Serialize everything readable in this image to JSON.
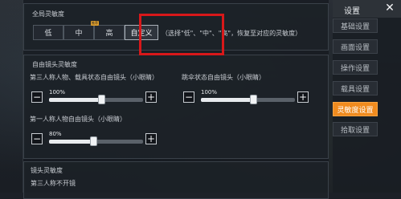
{
  "global": {
    "title": "全局灵敏度",
    "buttons": [
      "低",
      "中",
      "高",
      "自定义"
    ],
    "badge": "推荐",
    "hint": "（选择\"低\"、\"中\"、\"高\"，恢复至对应的灵敏度）"
  },
  "free_cam": {
    "title": "自由镜头灵敏度",
    "third_label": "第三人称人物、载具状态自由镜头（小眼睛）",
    "third_value": "100%",
    "third_level": 1.0,
    "parachute_label": "跳伞状态自由镜头（小眼睛）",
    "parachute_value": "100%",
    "parachute_level": 1.0,
    "first_label": "第一人称人物自由镜头（小眼睛）",
    "first_value": "80%",
    "first_level": 0.8
  },
  "lens": {
    "title": "镜头灵敏度",
    "first_row_label": "第三人称不开镜"
  },
  "menu": {
    "title": "设置",
    "close": "✕",
    "items": [
      "基础设置",
      "画面设置",
      "操作设置",
      "载具设置",
      "灵敏度设置",
      "拾取设置"
    ],
    "active_index": 4
  },
  "colors": {
    "accent": "#f08b1f",
    "highlight_box": "#d8181a"
  }
}
